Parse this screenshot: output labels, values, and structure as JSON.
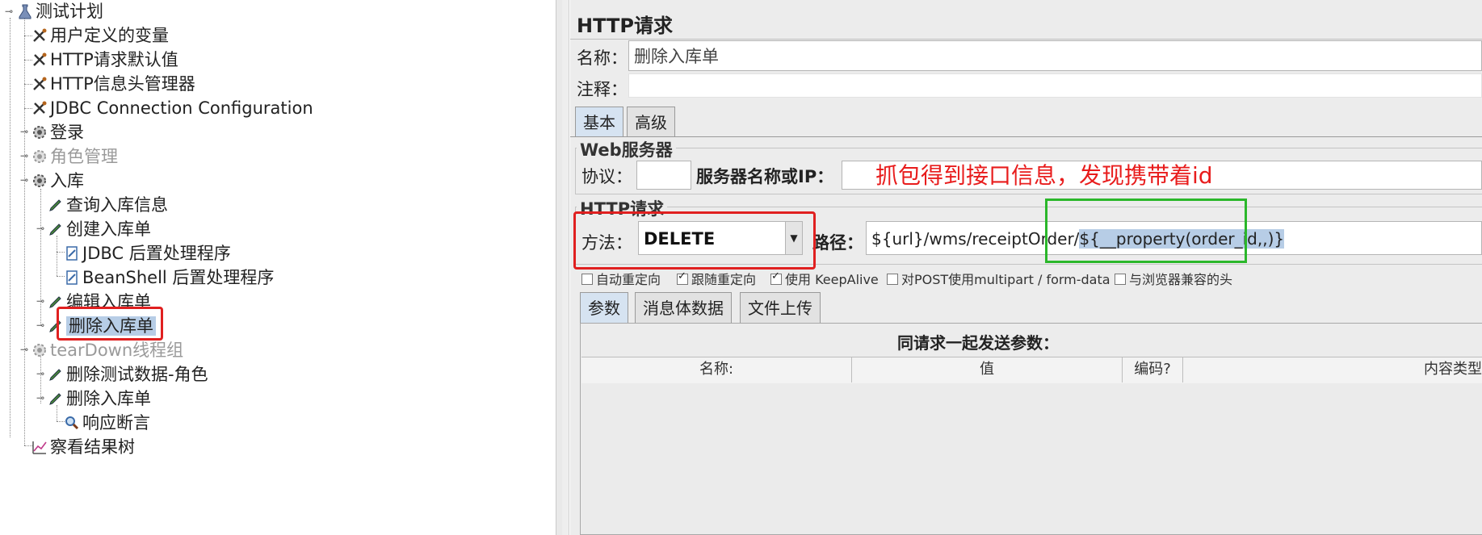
{
  "tree": {
    "items": [
      {
        "label": "测试计划",
        "icon": "flask-icon"
      },
      {
        "label": "用户定义的变量",
        "icon": "wrench-icon"
      },
      {
        "label": "HTTP请求默认值",
        "icon": "wrench-icon"
      },
      {
        "label": "HTTP信息头管理器",
        "icon": "wrench-icon"
      },
      {
        "label": "JDBC Connection Configuration",
        "icon": "wrench-icon"
      },
      {
        "label": "登录",
        "icon": "gear-icon"
      },
      {
        "label": "角色管理",
        "icon": "gear-icon"
      },
      {
        "label": "入库",
        "icon": "gear-icon"
      },
      {
        "label": "查询入库信息",
        "icon": "pipette-icon"
      },
      {
        "label": "创建入库单",
        "icon": "pipette-icon"
      },
      {
        "label": "JDBC 后置处理程序",
        "icon": "postprocessor-icon"
      },
      {
        "label": "BeanShell 后置处理程序",
        "icon": "postprocessor-icon"
      },
      {
        "label": "编辑入库单",
        "icon": "pipette-icon"
      },
      {
        "label": "删除入库单",
        "icon": "pipette-icon"
      },
      {
        "label": "tearDown线程组",
        "icon": "gear-icon"
      },
      {
        "label": "删除测试数据-角色",
        "icon": "pipette-icon"
      },
      {
        "label": "删除入库单",
        "icon": "pipette-icon"
      },
      {
        "label": "响应断言",
        "icon": "magnifier-icon"
      },
      {
        "label": "察看结果树",
        "icon": "graph-icon"
      }
    ]
  },
  "panel": {
    "title": "HTTP请求",
    "name_label": "名称：",
    "name_value": "删除入库单",
    "comment_label": "注释：",
    "comment_value": "",
    "tabs": [
      "基本",
      "高级"
    ],
    "web_server": {
      "group_title": "Web服务器",
      "protocol_label": "协议：",
      "protocol_value": "",
      "server_label": "服务器名称或IP：",
      "server_value": ""
    },
    "annotation": "抓包得到接口信息，发现携带着id",
    "http_request": {
      "group_title": "HTTP请求",
      "method_label": "方法：",
      "method_value": "DELETE",
      "path_label": "路径：",
      "path_prefix": "${url}/wms/receiptOrder/",
      "path_highlight": "${__property(order_id,,)}"
    },
    "checkboxes": [
      {
        "label": "自动重定向",
        "checked": false
      },
      {
        "label": "跟随重定向",
        "checked": true
      },
      {
        "label": "使用 KeepAlive",
        "checked": true
      },
      {
        "label": "对POST使用multipart / form-data",
        "checked": false
      },
      {
        "label": "与浏览器兼容的头",
        "checked": false
      }
    ],
    "param_tabs": [
      "参数",
      "消息体数据",
      "文件上传"
    ],
    "params_caption": "同请求一起发送参数：",
    "table_headers": [
      "名称:",
      "值",
      "编码?",
      "内容类型"
    ],
    "colors": {
      "red_box": "#e02020",
      "green_box": "#2ab72a",
      "annotation": "#e81c1c",
      "selection": "#b7cde6"
    }
  }
}
